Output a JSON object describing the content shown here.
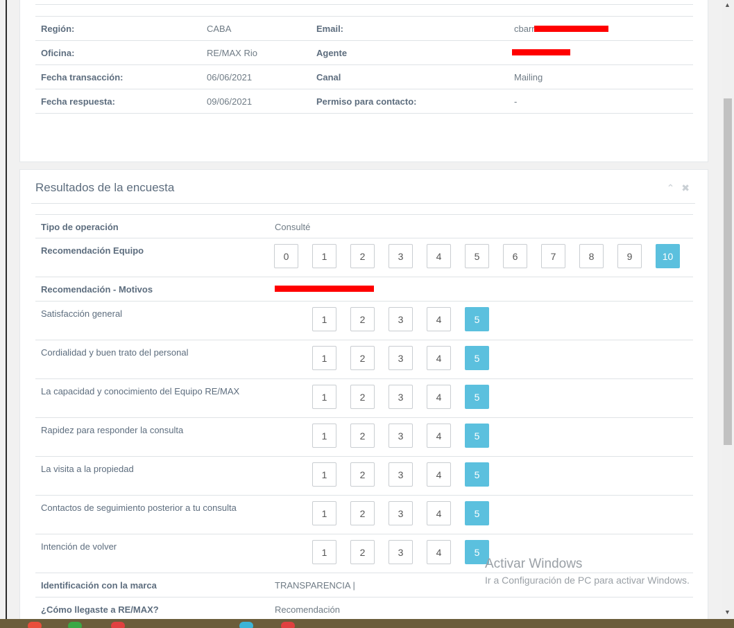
{
  "info": {
    "rows": [
      {
        "l1": "Región:",
        "v1": "CABA",
        "l2": "Email:",
        "v2": "cbarr"
      },
      {
        "l1": "Oficina:",
        "v1": "RE/MAX Rio",
        "l2": "Agente",
        "v2": ""
      },
      {
        "l1": "Fecha transacción:",
        "v1": "06/06/2021",
        "l2": "Canal",
        "v2": "Mailing"
      },
      {
        "l1": "Fecha respuesta:",
        "v1": "09/06/2021",
        "l2": "Permiso para contacto:",
        "v2": "-"
      }
    ]
  },
  "survey": {
    "title": "Resultados de la encuesta",
    "collapse_icon": "chevron-up-icon",
    "close_icon": "close-icon",
    "tipo_label": "Tipo de operación",
    "tipo_value": "Consulté",
    "reco_label": "Recomendación Equipo",
    "reco_scale": [
      "0",
      "1",
      "2",
      "3",
      "4",
      "5",
      "6",
      "7",
      "8",
      "9",
      "10"
    ],
    "reco_selected": "10",
    "motivos_label": "Recomendación - Motivos",
    "rating_scale": [
      "1",
      "2",
      "3",
      "4",
      "5"
    ],
    "ratings": [
      {
        "label": "Satisfacción general",
        "selected": "5"
      },
      {
        "label": "Cordialidad y buen trato del personal",
        "selected": "5"
      },
      {
        "label": "La capacidad y conocimiento del Equipo RE/MAX",
        "selected": "5"
      },
      {
        "label": "Rapidez para responder la consulta",
        "selected": "5"
      },
      {
        "label": "La visita a la propiedad",
        "selected": "5"
      },
      {
        "label": "Contactos de seguimiento posterior a tu consulta",
        "selected": "5"
      },
      {
        "label": "Intención de volver",
        "selected": "5"
      }
    ],
    "marca_label": "Identificación con la marca",
    "marca_value": "TRANSPARENCIA |",
    "llegaste_label": "¿Cómo llegaste a RE/MAX?",
    "llegaste_value": "Recomendación"
  },
  "watermark": {
    "line1": "Activar Windows",
    "line2": "Ir a Configuración de PC para activar Windows."
  },
  "colors": {
    "selected": "#5bc0de",
    "redaction": "#ff0000"
  }
}
